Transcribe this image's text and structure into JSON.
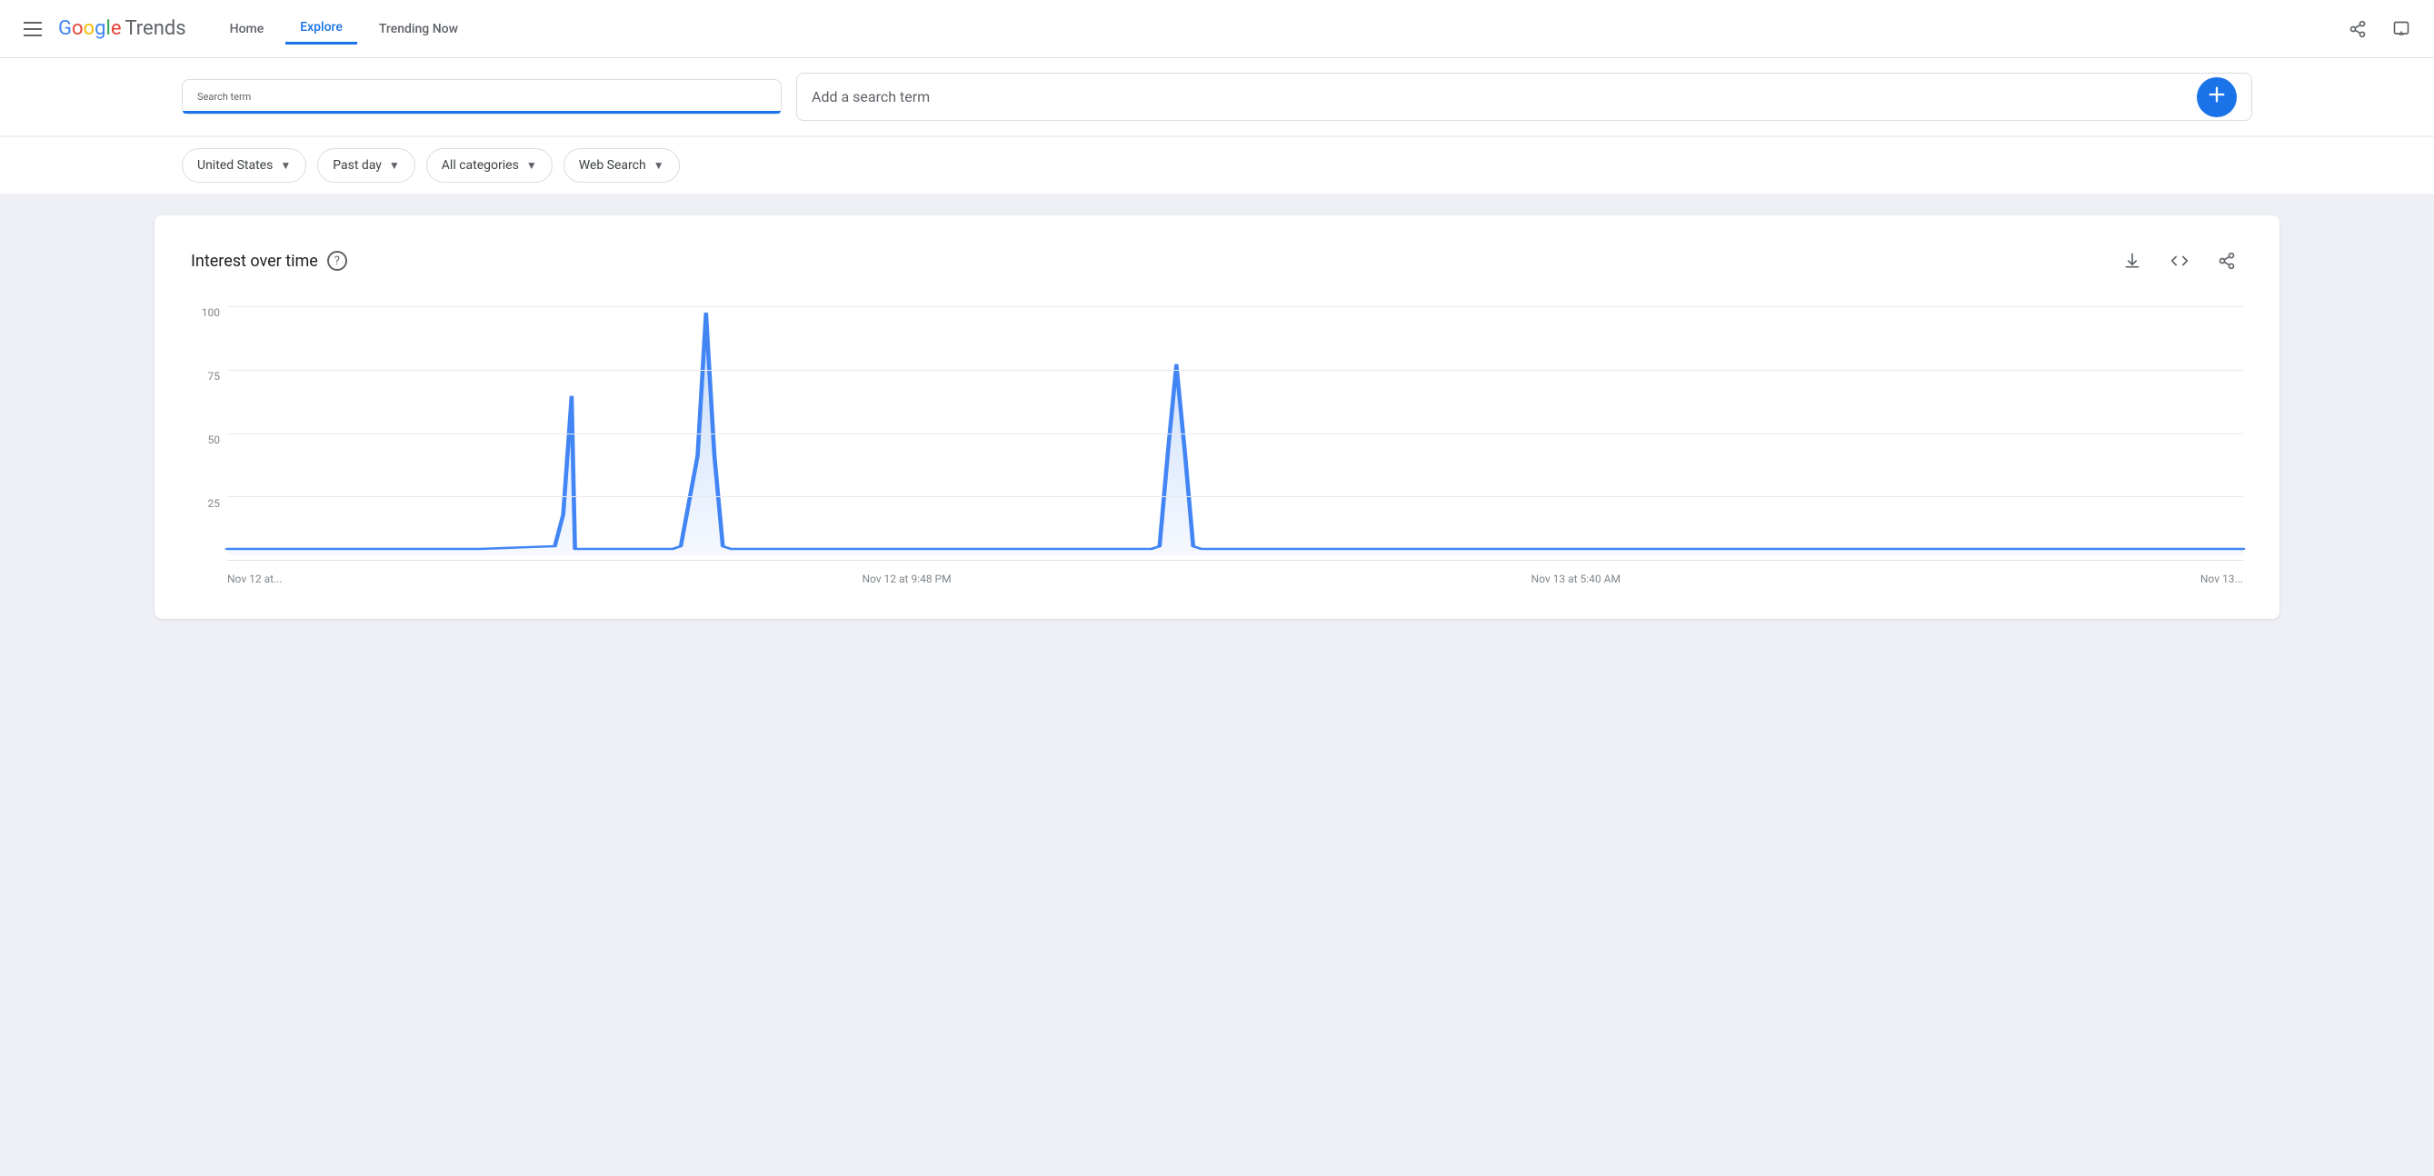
{
  "header": {
    "logo_google": "Google",
    "logo_trends": "Trends",
    "nav": {
      "home": "Home",
      "explore": "Explore",
      "trending_now": "Trending Now"
    },
    "active_nav": "explore"
  },
  "search": {
    "term_label": "Search term",
    "add_placeholder": "Add a search term"
  },
  "filters": {
    "location": "United States",
    "time": "Past day",
    "category": "All categories",
    "search_type": "Web Search"
  },
  "chart": {
    "title": "Interest over time",
    "help_label": "?",
    "y_labels": [
      "100",
      "75",
      "50",
      "25",
      ""
    ],
    "x_labels": [
      "Nov 12 at...",
      "Nov 12 at 9:48 PM",
      "Nov 13 at 5:40 AM",
      "Nov 13..."
    ],
    "download_icon": "↓",
    "embed_icon": "<>",
    "share_icon": "share"
  }
}
